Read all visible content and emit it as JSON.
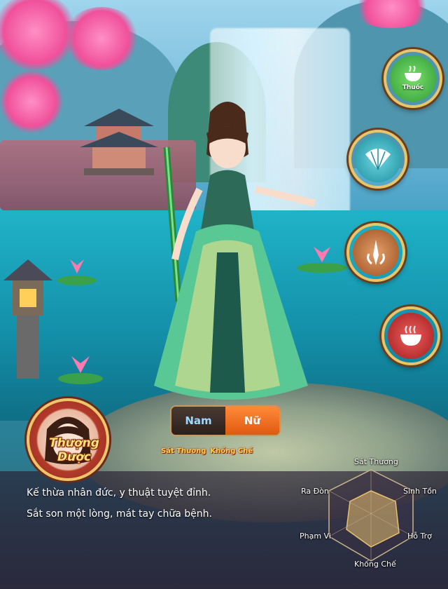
{
  "skills": [
    {
      "icon": "medicine-bowl-icon",
      "label": "Thuốc",
      "color": "#36b43c"
    },
    {
      "icon": "fan-icon",
      "label": "",
      "color": "#1aa0b0"
    },
    {
      "icon": "flame-blade-icon",
      "label": "",
      "color": "#b4622a"
    },
    {
      "icon": "steaming-bowl-icon",
      "label": "",
      "color": "#c22a2a"
    }
  ],
  "gender": {
    "male": "Nam",
    "female": "Nữ",
    "selected": "female"
  },
  "character": {
    "name": "Thượng Dược",
    "tags": [
      "Sát Thương",
      "Khống Chế"
    ],
    "description": [
      "Kế thừa nhân đức, y thuật tuyệt đỉnh.",
      "Sắt son một lòng, mát tay chữa bệnh."
    ]
  },
  "radar": {
    "labels": {
      "top": "Sát Thương",
      "upper_left": "Ra Đòn",
      "upper_right": "Sinh Tồn",
      "lower_left": "Phạm Vi",
      "lower_right": "Hỗ Trợ",
      "bottom": "Khống Chế"
    }
  }
}
